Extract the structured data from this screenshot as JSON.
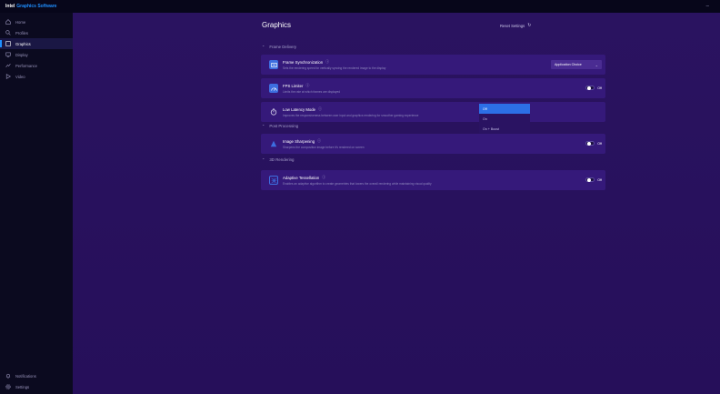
{
  "titlebar": {
    "brand_a": "Intel",
    "brand_b": "Graphics Software",
    "window_control": "–"
  },
  "sidebar": {
    "top": [
      {
        "label": "Home",
        "icon": "home-icon"
      },
      {
        "label": "Profiles",
        "icon": "profiles-icon"
      },
      {
        "label": "Graphics",
        "icon": "graphics-icon",
        "active": true
      },
      {
        "label": "Display",
        "icon": "display-icon"
      },
      {
        "label": "Performance",
        "icon": "performance-icon"
      },
      {
        "label": "Video",
        "icon": "video-icon"
      }
    ],
    "bottom": [
      {
        "label": "Notifications",
        "icon": "bell-icon"
      },
      {
        "label": "Settings",
        "icon": "gear-icon"
      }
    ]
  },
  "main": {
    "title": "Graphics",
    "reset_label": "Reset Settings",
    "sections": {
      "frame_delivery": "Frame Delivery",
      "post_processing": "Post Processing",
      "three_d_rendering": "3D Rendering"
    },
    "features": {
      "frame_sync": {
        "title": "Frame Synchronization",
        "desc": "Sets the rendering speed for vertically syncing the rendered image to the display",
        "value": "Application Choice"
      },
      "fps_limiter": {
        "title": "FPS Limiter",
        "desc": "Limits the rate at which frames are displayed",
        "value": "Off"
      },
      "low_latency": {
        "title": "Low Latency Mode",
        "desc": "Improves the responsiveness between user input and graphics rendering for smoother gaming experience"
      },
      "image_sharpening": {
        "title": "Image Sharpening",
        "desc": "Sharpens the composition image before it's rendered on screen",
        "value": "Off"
      },
      "adaptive_tessellation": {
        "title": "Adaptive Tessellation",
        "desc": "Enables an adaptive algorithm to create geometries that lowers the overall rendering while maintaining visual quality",
        "value": "Off"
      }
    },
    "latency_dropdown": {
      "options": [
        "Off",
        "On",
        "On + Boost"
      ],
      "selected": "Off"
    }
  },
  "colors": {
    "accent": "#1f8fff",
    "card": "#35197a",
    "main_bg": "#2a1360",
    "selected_option": "#2c6fe6"
  }
}
